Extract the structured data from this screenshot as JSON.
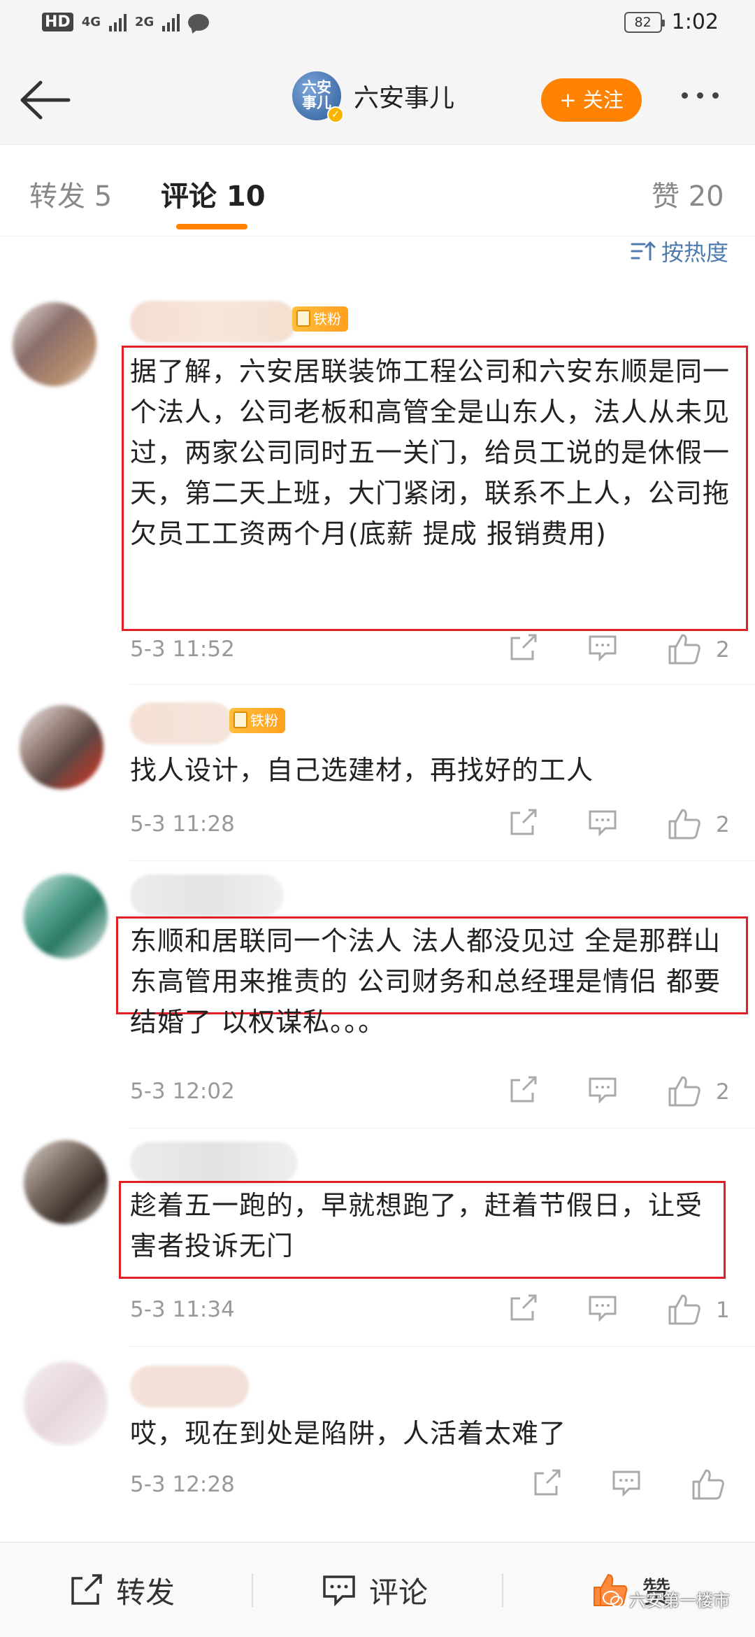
{
  "status_bar": {
    "hd": "HD",
    "net1": "4G",
    "net2": "2G",
    "battery": "82",
    "time": "1:02"
  },
  "header": {
    "avatar_text_top": "六安",
    "avatar_text_bottom": "事儿",
    "account_name": "六安事儿",
    "follow_label": "+ 关注"
  },
  "tabs": [
    {
      "label": "转发 5"
    },
    {
      "label": "评论 10"
    },
    {
      "label": "赞 20"
    }
  ],
  "sort_label": "按热度",
  "comments": [
    {
      "badge": "铁粉",
      "text": "据了解，六安居联装饰工程公司和六安东顺是同一个法人，公司老板和高管全是山东人，法人从未见过，两家公司同时五一关门，给员工说的是休假一天，第二天上班，大门紧闭，联系不上人，公司拖欠员工工资两个月(底薪 提成 报销费用)",
      "time": "5-3 11:52",
      "likes": "2"
    },
    {
      "badge": "铁粉",
      "text": "找人设计，自己选建材，再找好的工人",
      "time": "5-3 11:28",
      "likes": "2"
    },
    {
      "text": "东顺和居联同一个法人 法人都没见过 全是那群山东高管用来推责的 公司财务和总经理是情侣 都要结婚了 以权谋私。。。",
      "time": "5-3 12:02",
      "likes": "2"
    },
    {
      "text": "趁着五一跑的，早就想跑了，赶着节假日，让受害者投诉无门",
      "time": "5-3 11:34",
      "likes": "1"
    },
    {
      "text": "哎，现在到处是陷阱，人活着太难了",
      "time": "5-3 12:28",
      "likes": ""
    }
  ],
  "toolbar": {
    "repost": "转发",
    "comment": "评论",
    "like": "赞"
  },
  "watermark": "六安第一楼市",
  "colors": {
    "accent": "#ff8200",
    "highlight_box": "#e02027",
    "link_blue": "#4f7cae"
  }
}
